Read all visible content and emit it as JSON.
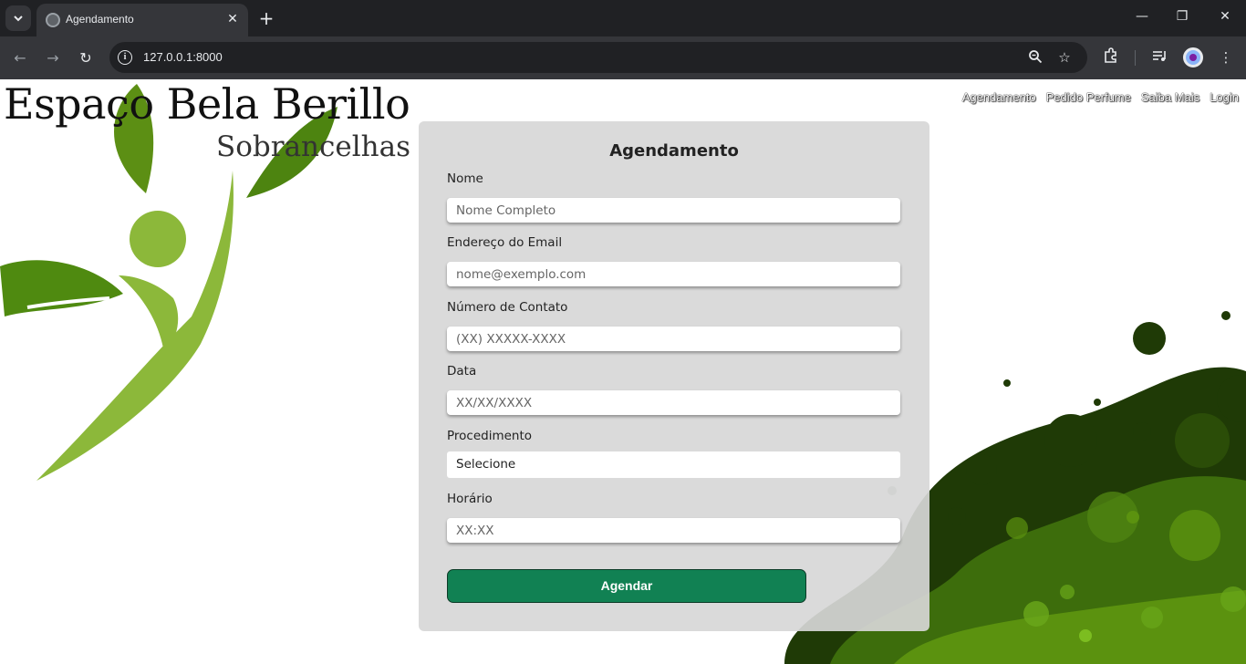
{
  "browser": {
    "tab_title": "Agendamento",
    "url": "127.0.0.1:8000",
    "tab_menu_icon": "chevron-down-icon",
    "new_tab_symbol": "+",
    "close_symbol": "✕"
  },
  "header": {
    "brand_title": "Espaço Bela Berillo",
    "brand_subtitle": "Sobrancelhas"
  },
  "nav": {
    "items": [
      "Agendamento",
      "Pedido Perfume",
      "Saiba Mais",
      "Login"
    ]
  },
  "form": {
    "title": "Agendamento",
    "fields": [
      {
        "label": "Nome",
        "placeholder": "Nome Completo"
      },
      {
        "label": "Endereço do Email",
        "placeholder": "nome@exemplo.com"
      },
      {
        "label": "Número de Contato",
        "placeholder": "(XX) XXXXX-XXXX"
      },
      {
        "label": "Data",
        "placeholder": "XX/XX/XXXX"
      },
      {
        "label": "Procedimento",
        "value": "Selecione"
      },
      {
        "label": "Horário",
        "placeholder": "XX:XX"
      }
    ],
    "submit_label": "Agendar"
  },
  "colors": {
    "accent": "#118153",
    "leaf_dark": "#4f8a10",
    "leaf_light": "#8cb83a",
    "blob_dark": "#1f3a06",
    "blob_mid": "#3d6d0c"
  }
}
